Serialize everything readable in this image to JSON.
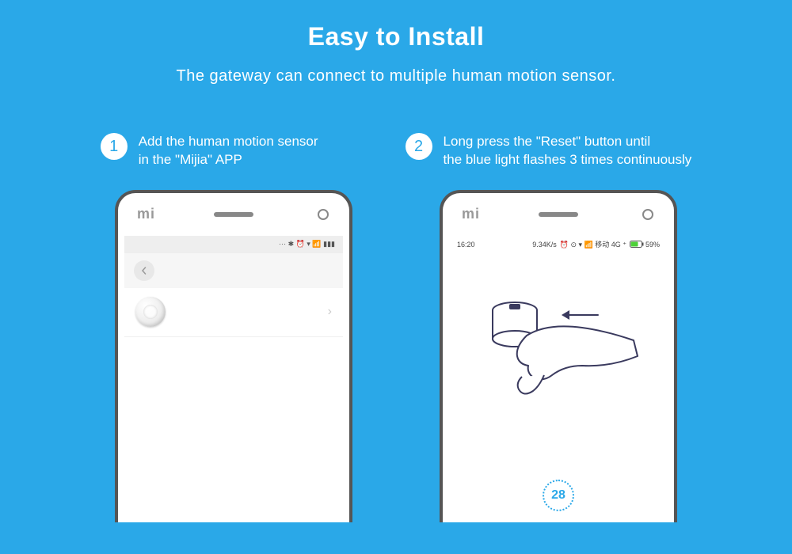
{
  "header": {
    "title": "Easy to Install",
    "subtitle": "The gateway can connect to multiple human motion sensor."
  },
  "steps": [
    {
      "num": "1",
      "text": "Add the human motion sensor\n in the \"Mijia\" APP"
    },
    {
      "num": "2",
      "text": "Long press the \"Reset\" button until\nthe blue light flashes 3 times continuously"
    }
  ],
  "phone1": {
    "logo": "mi",
    "status_icons": "··· ✱ ⏰ ▾ 📶 ▮▮▮"
  },
  "phone2": {
    "logo": "mi",
    "time": "16:20",
    "net_speed": "9.34K/s",
    "status_icons": "⏰ ⊙ ▾ 📶 移动 4G ⁺",
    "battery_text": "59%",
    "countdown": "28"
  }
}
